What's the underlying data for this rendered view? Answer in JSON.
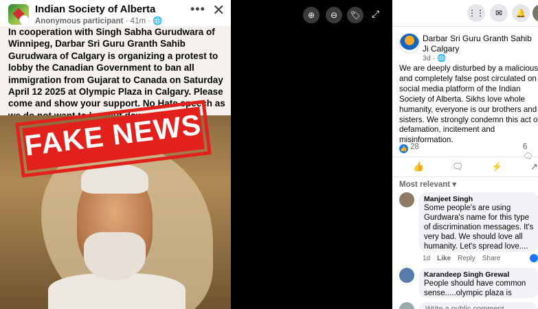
{
  "post": {
    "group_name": "Indian Society of Alberta",
    "author": "Anonymous participant",
    "time": "41m",
    "text": "In cooperation with Singh Sabha Gurudwara of Winnipeg, Darbar Sri Guru Granth Sahib Gurudwara of Calgary is organizing a protest to lobby the Canadian Government to ban all immigration from Gujarat to Canada on Saturday April 12 2025 at Olympic Plaza in Calgary. Please come and show your support. No Hate speech as we do not want to be shut down.",
    "stamp": "FAKE NEWS"
  },
  "viewer_controls": {
    "zoom_in_icon": "zoom-in-icon",
    "zoom_out_icon": "zoom-out-icon",
    "tag_icon": "tag-icon",
    "expand_icon": "expand-icon"
  },
  "panel": {
    "page_name": "Darbar Sri Guru Granth Sahib Ji Calgary",
    "time": "3d",
    "text": "We are deeply disturbed by a malicious and completely false post circulated on social media platform of the Indian Society of Alberta. Sikhs love whole humanity, everyone is our brothers and sisters. We strongly condemn this act of defamation, incitement and misinformation.",
    "likes": "28",
    "comments": "6",
    "sort_label": "Most relevant",
    "comments_list": [
      {
        "name": "Manjeet Singh",
        "text": "Some people's are using Gurdwara's name for this type of discrimination messages. It's very bad. We should love all humanity. Let's spread love....",
        "time": "1d",
        "like": "Like",
        "reply": "Reply",
        "share": "Share"
      },
      {
        "name": "Karandeep Singh Grewal",
        "text": "People should have common sense.....olympic plaza is"
      }
    ],
    "write_placeholder": "Write a public comment…"
  },
  "colors": {
    "accent": "#1877f2",
    "stamp": "#e3211c"
  }
}
